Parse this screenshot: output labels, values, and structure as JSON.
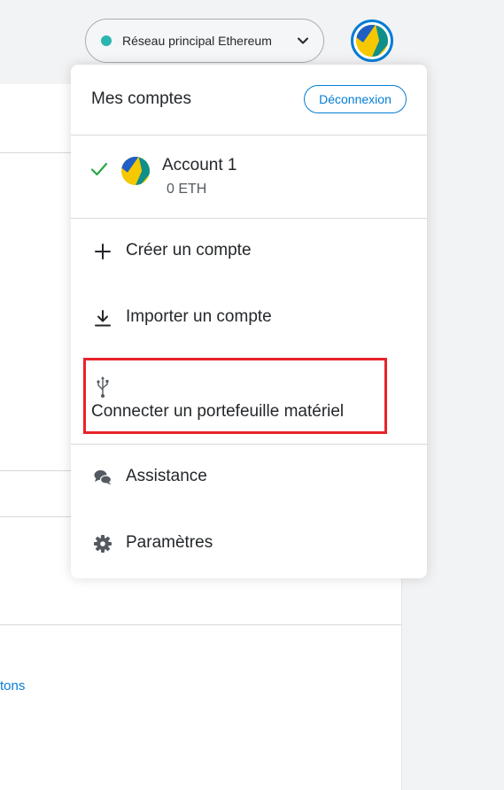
{
  "network": {
    "label": "Réseau principal Ethereum",
    "dot_color": "#29b6af",
    "icon": "chevron-down-icon"
  },
  "menu": {
    "title": "Mes comptes",
    "logout_label": "Déconnexion",
    "account": {
      "name": "Account 1",
      "balance": "0 ETH",
      "selected": true
    },
    "items": [
      {
        "label": "Créer un compte",
        "icon": "plus-icon"
      },
      {
        "label": "Importer un compte",
        "icon": "download-icon"
      },
      {
        "label": "Connecter un portefeuille matériel",
        "icon": "usb-icon",
        "highlighted": true
      },
      {
        "label": "Assistance",
        "icon": "chat-bubbles-icon"
      },
      {
        "label": "Paramètres",
        "icon": "gear-icon"
      }
    ]
  },
  "background": {
    "link_text": "tons"
  },
  "colors": {
    "accent": "#037dd6",
    "highlight": "#e8232a",
    "check": "#28a745"
  }
}
